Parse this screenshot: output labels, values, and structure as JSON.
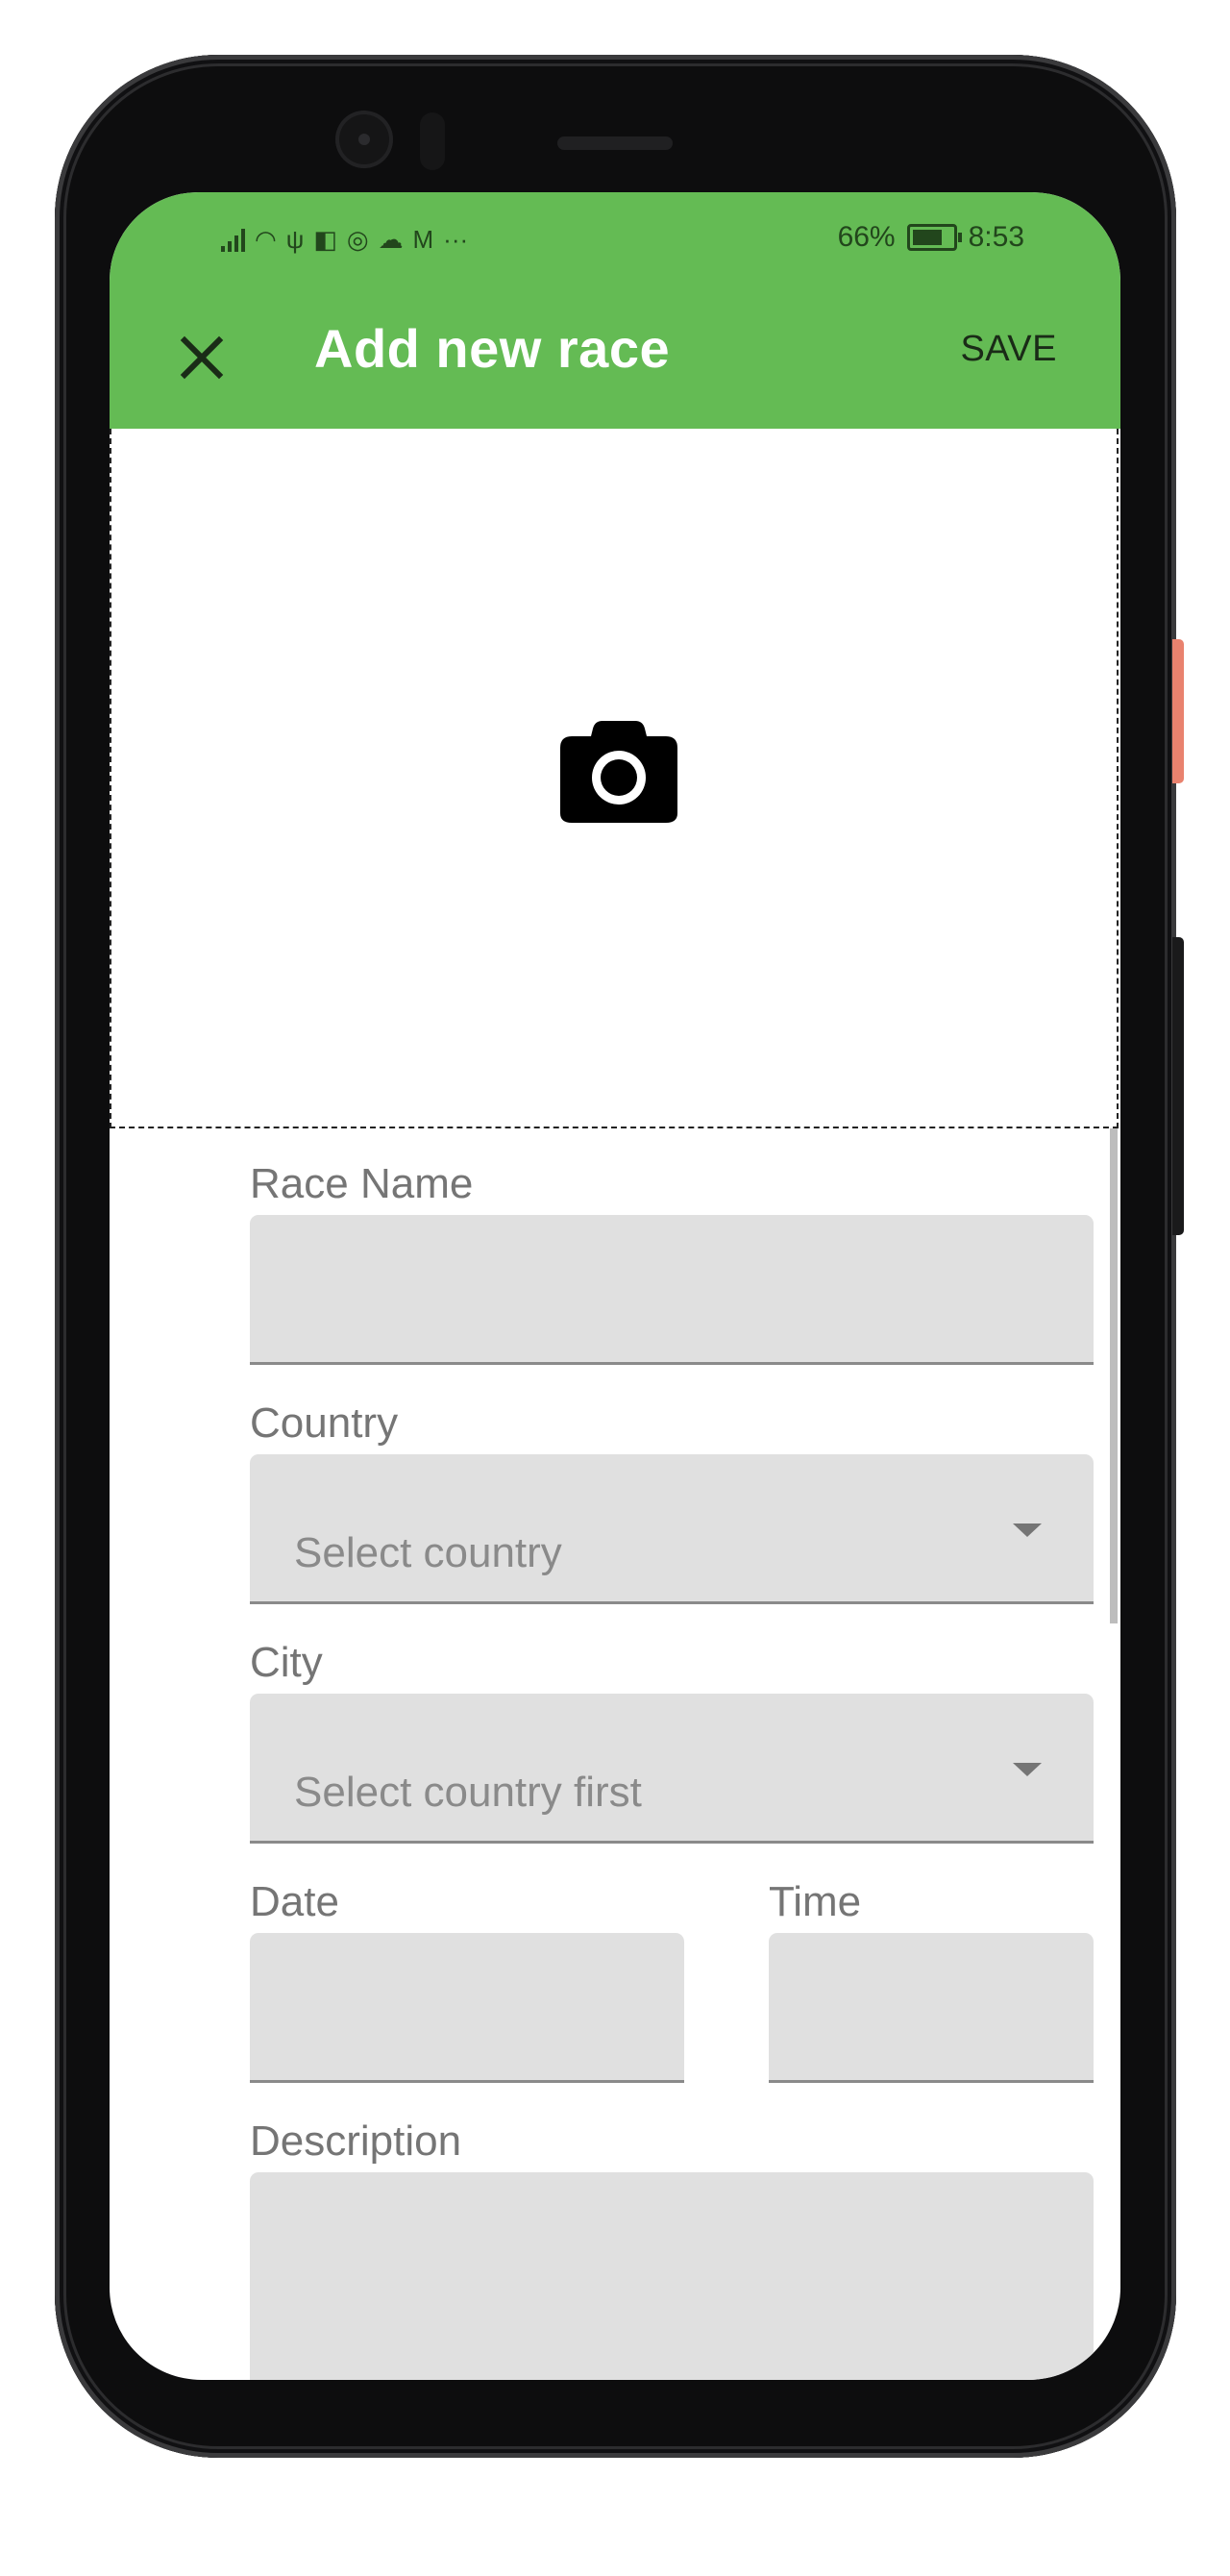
{
  "status_bar": {
    "battery": "66%",
    "time": "8:53",
    "icons": [
      "signal-icon",
      "wifi-icon",
      "usb-icon",
      "shield-app-icon",
      "chrome-app-icon",
      "cloud-icon",
      "gmail-icon",
      "more-dots-icon"
    ]
  },
  "toolbar": {
    "close_icon": "close-icon",
    "title": "Add new race",
    "save_label": "SAVE"
  },
  "photo": {
    "icon": "camera-icon"
  },
  "form": {
    "race_name": {
      "label": "Race Name",
      "value": ""
    },
    "country": {
      "label": "Country",
      "placeholder": "Select country"
    },
    "city": {
      "label": "City",
      "placeholder": "Select country first"
    },
    "date": {
      "label": "Date",
      "value": ""
    },
    "time": {
      "label": "Time",
      "value": ""
    },
    "description": {
      "label": "Description",
      "value": ""
    }
  },
  "colors": {
    "appbar": "#64bb54",
    "field_bg": "#e0e0e0",
    "label": "#757575",
    "title": "#ffffff"
  }
}
